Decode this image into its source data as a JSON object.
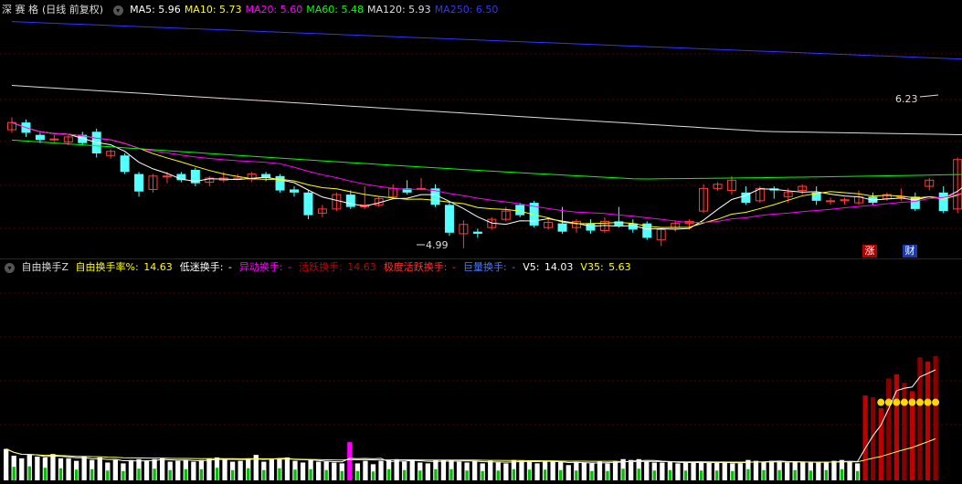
{
  "main": {
    "stock_name": "深 赛 格",
    "period_label": "(日线 前复权)",
    "ma": [
      {
        "label": "MA5: 5.96",
        "color": "#ffffff"
      },
      {
        "label": "MA10: 5.73",
        "color": "#ffff00"
      },
      {
        "label": "MA20: 5.60",
        "color": "#ff00ff"
      },
      {
        "label": "MA60: 5.48",
        "color": "#00ff00"
      },
      {
        "label": "MA120: 5.93",
        "color": "#dddddd"
      },
      {
        "label": "MA250: 6.50",
        "color": "#3333ff"
      }
    ],
    "high_label": "6.23",
    "low_label": "4.99",
    "badges": [
      {
        "text": "涨",
        "color": "#b00000"
      },
      {
        "text": "财",
        "color": "#1a3aa8"
      }
    ]
  },
  "sub": {
    "indicator_name": "自由换手Z",
    "items": [
      {
        "label": "自由换手率%:",
        "value": "14.63",
        "color": "#ffff00"
      },
      {
        "label": "低迷换手:",
        "value": "-",
        "color": "#ffffff"
      },
      {
        "label": "异动换手:",
        "value": "-",
        "color": "#ff00ff"
      },
      {
        "label": "活跃换手:",
        "value": "14.63",
        "color": "#c00000"
      },
      {
        "label": "极度活跃换手:",
        "value": "-",
        "color": "#ff3030"
      },
      {
        "label": "巨量换手:",
        "value": "-",
        "color": "#4a7aff"
      },
      {
        "label": "V5:",
        "value": "14.03",
        "color": "#ffffff"
      },
      {
        "label": "V35:",
        "value": "5.63",
        "color": "#ffff00"
      }
    ]
  },
  "chart_data": [
    {
      "type": "candlestick",
      "price_axis": [
        4.6,
        6.95
      ],
      "candles": [
        [
          5.85,
          5.92,
          5.97,
          5.82
        ],
        [
          5.92,
          5.82,
          5.95,
          5.78
        ],
        [
          5.8,
          5.75,
          5.82,
          5.72
        ],
        [
          5.76,
          5.76,
          5.8,
          5.73
        ],
        [
          5.73,
          5.78,
          5.8,
          5.7
        ],
        [
          5.8,
          5.72,
          5.83,
          5.7
        ],
        [
          5.83,
          5.62,
          5.86,
          5.58
        ],
        [
          5.6,
          5.64,
          5.66,
          5.57
        ],
        [
          5.6,
          5.44,
          5.62,
          5.42
        ],
        [
          5.42,
          5.25,
          5.44,
          5.2
        ],
        [
          5.27,
          5.4,
          5.42,
          5.24
        ],
        [
          5.4,
          5.4,
          5.44,
          5.33
        ],
        [
          5.42,
          5.36,
          5.44,
          5.34
        ],
        [
          5.46,
          5.33,
          5.48,
          5.3
        ],
        [
          5.34,
          5.38,
          5.4,
          5.3
        ],
        [
          5.36,
          5.38,
          5.44,
          5.34
        ],
        [
          5.37,
          5.38,
          5.42,
          5.36
        ],
        [
          5.37,
          5.42,
          5.44,
          5.34
        ],
        [
          5.42,
          5.38,
          5.44,
          5.35
        ],
        [
          5.4,
          5.26,
          5.42,
          5.24
        ],
        [
          5.27,
          5.24,
          5.3,
          5.2
        ],
        [
          5.24,
          5.02,
          5.26,
          4.98
        ],
        [
          5.04,
          5.08,
          5.12,
          5.0
        ],
        [
          5.08,
          5.22,
          5.24,
          5.06
        ],
        [
          5.22,
          5.1,
          5.26,
          5.08
        ],
        [
          5.1,
          5.12,
          5.3,
          5.08
        ],
        [
          5.12,
          5.18,
          5.2,
          5.1
        ],
        [
          5.2,
          5.28,
          5.32,
          5.18
        ],
        [
          5.28,
          5.24,
          5.36,
          5.22
        ],
        [
          5.28,
          5.28,
          5.38,
          5.26
        ],
        [
          5.28,
          5.12,
          5.32,
          5.1
        ],
        [
          5.12,
          4.85,
          5.14,
          4.82
        ],
        [
          4.84,
          4.93,
          4.97,
          4.7
        ],
        [
          4.86,
          4.84,
          4.89,
          4.8
        ],
        [
          4.9,
          4.98,
          5.0,
          4.88
        ],
        [
          4.98,
          5.06,
          5.1,
          4.96
        ],
        [
          5.12,
          5.02,
          5.14,
          5.0
        ],
        [
          5.14,
          4.92,
          5.16,
          4.9
        ],
        [
          4.9,
          4.95,
          5.0,
          4.88
        ],
        [
          4.94,
          4.86,
          5.1,
          4.84
        ],
        [
          4.9,
          4.96,
          4.98,
          4.85
        ],
        [
          4.94,
          4.87,
          4.98,
          4.84
        ],
        [
          4.87,
          4.96,
          5.0,
          4.85
        ],
        [
          4.96,
          4.92,
          5.1,
          4.9
        ],
        [
          4.94,
          4.88,
          4.98,
          4.85
        ],
        [
          4.94,
          4.8,
          4.96,
          4.78
        ],
        [
          4.78,
          4.88,
          4.9,
          4.72
        ],
        [
          4.9,
          4.94,
          4.97,
          4.86
        ],
        [
          4.94,
          4.96,
          4.98,
          4.88
        ],
        [
          5.06,
          5.28,
          5.32,
          5.04
        ],
        [
          5.28,
          5.32,
          5.34,
          5.26
        ],
        [
          5.26,
          5.36,
          5.4,
          5.22
        ],
        [
          5.24,
          5.14,
          5.3,
          5.12
        ],
        [
          5.16,
          5.28,
          5.3,
          5.14
        ],
        [
          5.28,
          5.26,
          5.3,
          5.18
        ],
        [
          5.2,
          5.24,
          5.28,
          5.14
        ],
        [
          5.26,
          5.3,
          5.32,
          5.22
        ],
        [
          5.24,
          5.16,
          5.3,
          5.12
        ],
        [
          5.16,
          5.16,
          5.19,
          5.12
        ],
        [
          5.16,
          5.17,
          5.19,
          5.12
        ],
        [
          5.14,
          5.2,
          5.26,
          5.12
        ],
        [
          5.2,
          5.14,
          5.24,
          5.12
        ],
        [
          5.18,
          5.22,
          5.24,
          5.16
        ],
        [
          5.2,
          5.2,
          5.28,
          5.16
        ],
        [
          5.2,
          5.08,
          5.24,
          5.06
        ],
        [
          5.3,
          5.36,
          5.38,
          5.26
        ],
        [
          5.24,
          5.06,
          5.3,
          5.04
        ],
        [
          5.08,
          5.56,
          5.58,
          5.04
        ],
        [
          5.58,
          5.74,
          5.82,
          5.56
        ],
        [
          5.66,
          5.66,
          5.86,
          5.62
        ],
        [
          5.64,
          5.78,
          5.8,
          5.6
        ],
        [
          5.74,
          5.82,
          5.92,
          5.72
        ],
        [
          5.82,
          5.7,
          5.94,
          5.66
        ],
        [
          5.7,
          5.9,
          6.04,
          5.68
        ],
        [
          5.86,
          5.94,
          5.98,
          5.78
        ]
      ],
      "annotations": [
        "6.23",
        "4.99"
      ]
    },
    {
      "type": "bar",
      "title": "自由换手Z",
      "series": [
        {
          "name": "自由换手率%",
          "values": [
            3.7,
            2.9,
            2.6,
            3.0,
            2.8,
            2.7,
            3.1,
            2.6,
            2.6,
            2.3,
            2.8,
            2.4,
            2.7,
            2.1,
            2.4,
            2.0,
            2.4,
            2.5,
            2.3,
            2.5,
            2.6,
            2.2,
            2.3,
            2.4,
            2.2,
            2.4,
            2.6,
            2.7,
            2.5,
            2.2,
            2.3,
            2.6,
            3.0,
            2.2,
            2.5,
            2.6,
            2.7,
            2.3,
            2.1,
            2.4,
            2.2,
            2.2,
            2.1,
            2.0,
            4.5,
            2.0,
            2.3,
            1.9,
            2.3,
            2.4,
            2.5,
            2.2,
            2.4,
            2.1,
            2.0,
            2.4,
            2.4,
            2.4,
            2.2,
            2.1,
            2.3,
            2.0,
            2.3,
            2.1,
            2.0,
            2.4,
            2.3,
            2.3,
            2.0,
            2.3,
            2.2,
            2.2,
            1.8,
            2.1,
            2.1,
            2.0,
            2.2,
            2.0,
            2.2,
            2.5,
            2.4,
            2.5,
            2.2,
            2.1,
            2.1,
            2.2,
            2.0,
            2.1,
            2.1,
            2.1,
            2.1,
            2.1,
            2.1,
            2.0,
            2.0,
            2.4,
            2.3,
            2.2,
            2.3,
            2.2,
            2.1,
            2.2,
            2.1,
            2.1,
            2.1,
            2.2,
            2.3,
            2.4,
            2.2,
            2.0,
            10.0,
            9.8,
            8.5,
            12.0,
            12.5,
            11.5,
            10.5,
            14.5,
            14.0,
            14.63
          ]
        },
        {
          "name": "V5",
          "values": [
            2.7,
            2.9,
            2.5,
            2.4,
            14.03
          ]
        },
        {
          "name": "V35",
          "values": [
            2.6,
            2.5,
            2.5,
            2.4,
            5.63
          ]
        }
      ]
    }
  ]
}
